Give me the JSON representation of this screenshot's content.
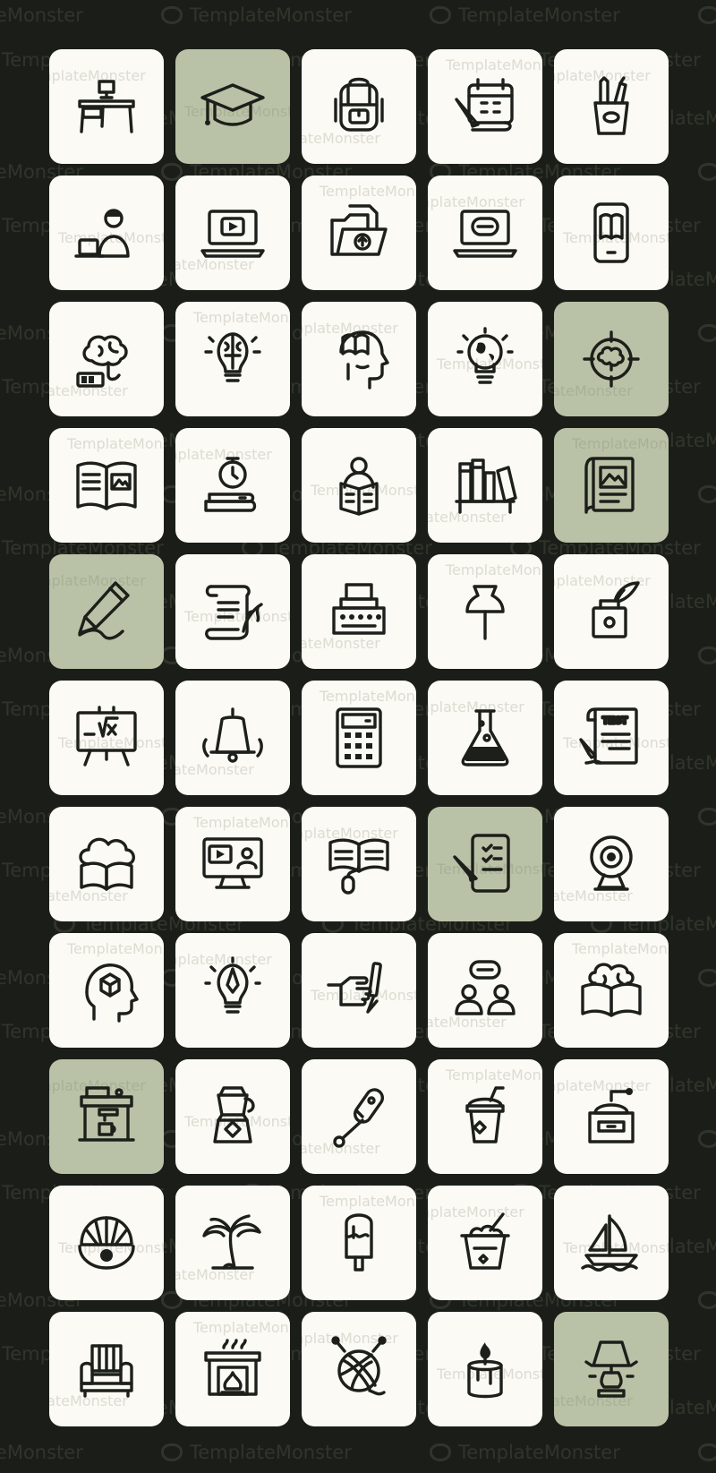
{
  "watermark_text": "TemplateMonster",
  "colors": {
    "background": "#1b1e18",
    "tile": "#fbfaf4",
    "tile_highlight": "#b9c2a6",
    "icon": "#1c1f1a"
  },
  "icons": [
    {
      "name": "desk-icon",
      "highlighted": false
    },
    {
      "name": "graduation-cap-icon",
      "highlighted": true
    },
    {
      "name": "backpack-icon",
      "highlighted": false
    },
    {
      "name": "calendar-pencil-icon",
      "highlighted": false
    },
    {
      "name": "pencil-cup-icon",
      "highlighted": false
    },
    {
      "name": "person-laptop-icon",
      "highlighted": false
    },
    {
      "name": "laptop-video-icon",
      "highlighted": false
    },
    {
      "name": "folder-upload-icon",
      "highlighted": false
    },
    {
      "name": "laptop-chat-icon",
      "highlighted": false
    },
    {
      "name": "phone-book-icon",
      "highlighted": false
    },
    {
      "name": "brain-battery-icon",
      "highlighted": false
    },
    {
      "name": "brain-bulb-icon",
      "highlighted": false
    },
    {
      "name": "head-book-icon",
      "highlighted": false
    },
    {
      "name": "bulb-globe-icon",
      "highlighted": false
    },
    {
      "name": "brain-target-icon",
      "highlighted": true
    },
    {
      "name": "open-book-icon",
      "highlighted": false
    },
    {
      "name": "clock-books-icon",
      "highlighted": false
    },
    {
      "name": "person-reading-icon",
      "highlighted": false
    },
    {
      "name": "bookshelf-icon",
      "highlighted": false
    },
    {
      "name": "notebook-icon",
      "highlighted": true
    },
    {
      "name": "pencil-scribble-icon",
      "highlighted": true
    },
    {
      "name": "scroll-quill-icon",
      "highlighted": false
    },
    {
      "name": "typewriter-icon",
      "highlighted": false
    },
    {
      "name": "pushpin-icon",
      "highlighted": false
    },
    {
      "name": "ink-bottle-icon",
      "highlighted": false
    },
    {
      "name": "chalkboard-math-icon",
      "highlighted": false
    },
    {
      "name": "school-bell-icon",
      "highlighted": false
    },
    {
      "name": "calculator-icon",
      "highlighted": false
    },
    {
      "name": "flask-icon",
      "highlighted": false
    },
    {
      "name": "test-paper-icon",
      "highlighted": false
    },
    {
      "name": "cloud-book-icon",
      "highlighted": false
    },
    {
      "name": "monitor-video-call-icon",
      "highlighted": false
    },
    {
      "name": "book-mouse-icon",
      "highlighted": false
    },
    {
      "name": "tablet-checklist-icon",
      "highlighted": true
    },
    {
      "name": "webcam-icon",
      "highlighted": false
    },
    {
      "name": "head-cube-icon",
      "highlighted": false
    },
    {
      "name": "bulb-pen-icon",
      "highlighted": false
    },
    {
      "name": "hand-pencil-icon",
      "highlighted": false
    },
    {
      "name": "two-people-chat-icon",
      "highlighted": false
    },
    {
      "name": "brain-book-icon",
      "highlighted": false
    },
    {
      "name": "coffee-machine-icon",
      "highlighted": true
    },
    {
      "name": "moka-pot-icon",
      "highlighted": false
    },
    {
      "name": "milk-frother-icon",
      "highlighted": false
    },
    {
      "name": "iced-drink-icon",
      "highlighted": false
    },
    {
      "name": "coffee-grinder-icon",
      "highlighted": false
    },
    {
      "name": "pearl-shell-icon",
      "highlighted": false
    },
    {
      "name": "palm-tree-icon",
      "highlighted": false
    },
    {
      "name": "popsicle-icon",
      "highlighted": false
    },
    {
      "name": "ice-bucket-icon",
      "highlighted": false
    },
    {
      "name": "sailboat-icon",
      "highlighted": false
    },
    {
      "name": "armchair-icon",
      "highlighted": false
    },
    {
      "name": "fireplace-icon",
      "highlighted": false
    },
    {
      "name": "yarn-ball-icon",
      "highlighted": false
    },
    {
      "name": "candle-icon",
      "highlighted": false
    },
    {
      "name": "table-lamp-icon",
      "highlighted": true
    }
  ],
  "test_label": "TEST"
}
